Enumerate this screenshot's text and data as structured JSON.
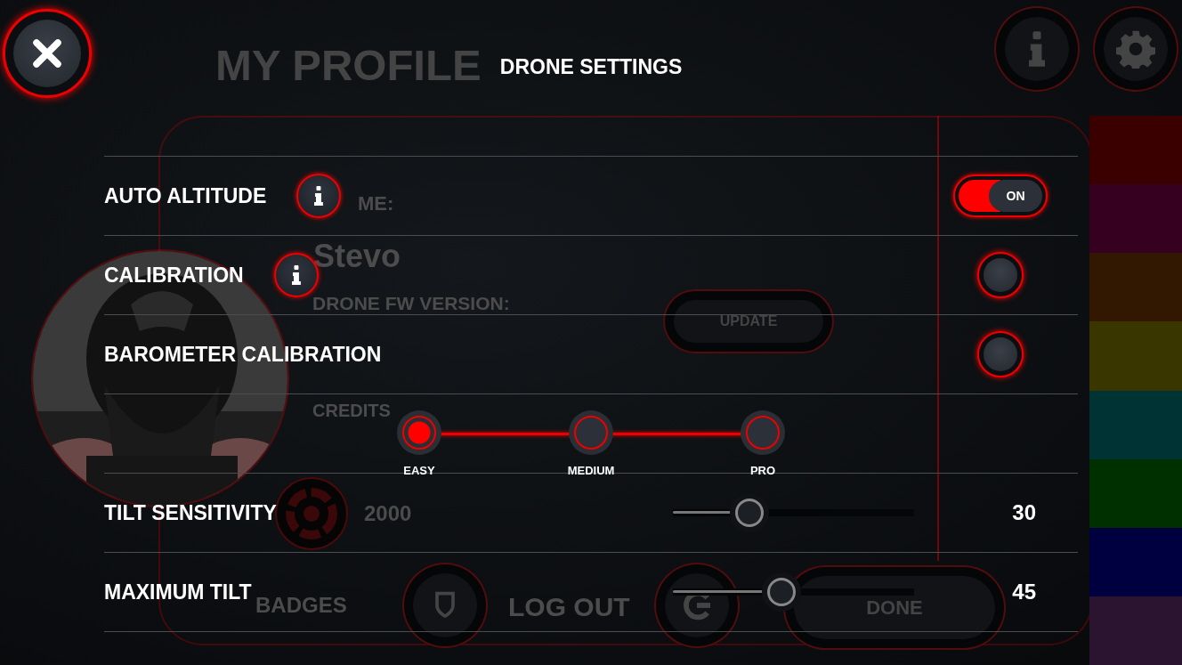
{
  "title": "DRONE SETTINGS",
  "settings": [
    {
      "kind": "toggle",
      "label": "AUTO ALTITUDE",
      "info": true,
      "on": true,
      "state_label": "ON"
    },
    {
      "kind": "button",
      "label": "CALIBRATION",
      "info": true
    },
    {
      "kind": "button",
      "label": "BAROMETER CALIBRATION",
      "info": false
    },
    {
      "kind": "levels",
      "options": [
        {
          "label": "EASY",
          "selected": true
        },
        {
          "label": "MEDIUM",
          "selected": false
        },
        {
          "label": "PRO",
          "selected": false
        }
      ]
    },
    {
      "kind": "slider",
      "label": "TILT SENSITIVITY",
      "level": 0.28,
      "reading": "30"
    },
    {
      "kind": "slider",
      "label": "MAXIMUM TILT",
      "level": 0.44,
      "reading": "45"
    }
  ],
  "color_swatches": [
    {
      "color": "#3a0000"
    },
    {
      "color": "#360020"
    },
    {
      "color": "#321800"
    },
    {
      "color": "#3a3600"
    },
    {
      "color": "#003434"
    },
    {
      "color": "#003000"
    },
    {
      "color": "#000040"
    },
    {
      "color": "#2a1430"
    }
  ],
  "background_profile": {
    "title": "MY PROFILE",
    "name_label": "ME:",
    "name": "Stevo",
    "fw_label": "DRONE FW VERSION:",
    "update_button": "UPDATE",
    "credits_label": "CREDITS",
    "credits": "2000",
    "badges_label": "BADGES",
    "log_out_label": "LOG OUT",
    "done_button": "DONE"
  }
}
